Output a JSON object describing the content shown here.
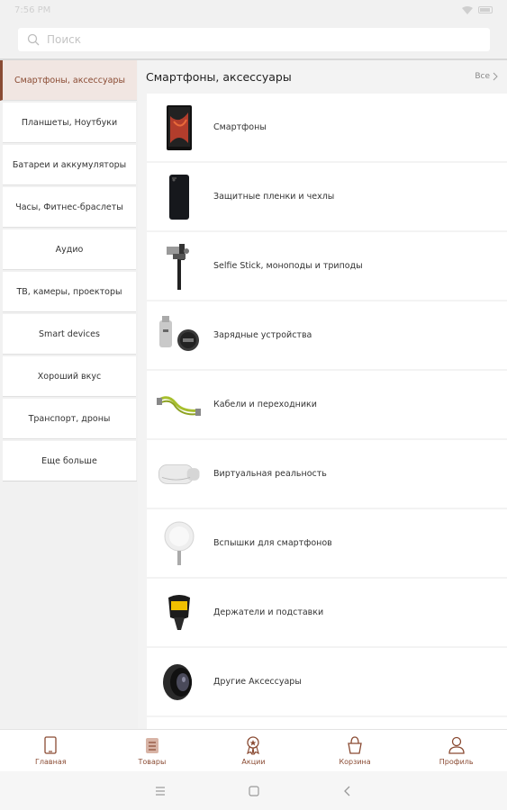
{
  "status_bar": {
    "time": "7:56 PM"
  },
  "search": {
    "placeholder": "Поиск"
  },
  "sidebar": {
    "items": [
      {
        "label": "Смартфоны, аксессуары",
        "active": true
      },
      {
        "label": "Планшеты, Ноутбуки"
      },
      {
        "label": "Батареи и аккумуляторы"
      },
      {
        "label": "Часы, Фитнес-браслеты"
      },
      {
        "label": "Аудио"
      },
      {
        "label": "ТВ, камеры, проекторы"
      },
      {
        "label": "Smart devices"
      },
      {
        "label": "Хороший вкус"
      },
      {
        "label": "Транспорт, дроны"
      },
      {
        "label": "Еще больше"
      }
    ]
  },
  "content": {
    "title": "Смартфоны, аксессуары",
    "see_all": "Все",
    "categories": [
      {
        "label": "Смартфоны",
        "icon": "smartphone-icon"
      },
      {
        "label": "Защитные пленки и чехлы",
        "icon": "phone-case-icon"
      },
      {
        "label": "Selfie Stick, моноподы и триподы",
        "icon": "selfie-stick-icon"
      },
      {
        "label": "Зарядные устройства",
        "icon": "charger-icon"
      },
      {
        "label": "Кабели и переходники",
        "icon": "cable-icon"
      },
      {
        "label": "Виртуальная реальность",
        "icon": "vr-headset-icon"
      },
      {
        "label": "Вспышки для смартфонов",
        "icon": "flash-icon"
      },
      {
        "label": "Держатели и подставки",
        "icon": "holder-icon"
      },
      {
        "label": "Другие Аксессуары",
        "icon": "lens-icon"
      }
    ]
  },
  "tabbar": {
    "items": [
      {
        "label": "Главная",
        "icon": "home-icon"
      },
      {
        "label": "Товары",
        "icon": "goods-icon"
      },
      {
        "label": "Акции",
        "icon": "badge-icon"
      },
      {
        "label": "Корзина",
        "icon": "basket-icon"
      },
      {
        "label": "Профиль",
        "icon": "profile-icon"
      }
    ]
  },
  "colors": {
    "accent": "#8a4b33",
    "active_bg": "#f1e6e2"
  }
}
